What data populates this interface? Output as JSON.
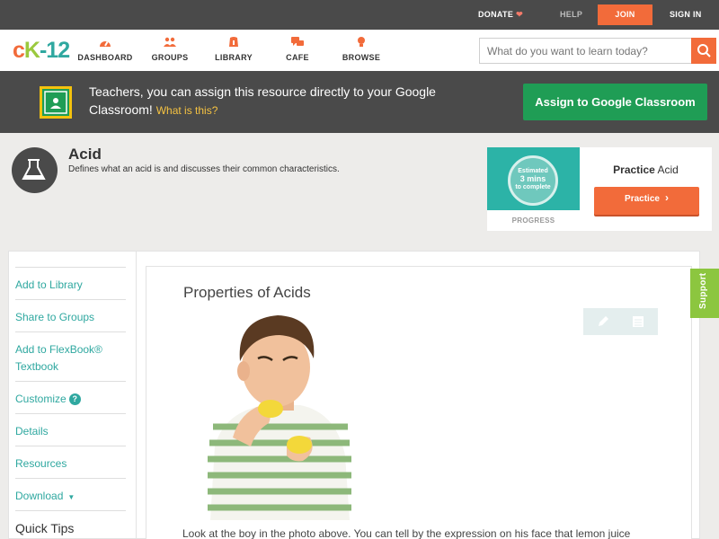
{
  "topbar": {
    "donate": "DONATE",
    "help": "HELP",
    "join": "JOIN",
    "signin": "SIGN IN"
  },
  "logo": {
    "c": "c",
    "k": "K",
    "n": "-12"
  },
  "nav": [
    {
      "label": "DASHBOARD",
      "icon": "dashboard-icon"
    },
    {
      "label": "GROUPS",
      "icon": "groups-icon"
    },
    {
      "label": "LIBRARY",
      "icon": "library-icon"
    },
    {
      "label": "CAFE",
      "icon": "cafe-icon"
    },
    {
      "label": "BROWSE",
      "icon": "browse-icon"
    }
  ],
  "search": {
    "placeholder": "What do you want to learn today?"
  },
  "banner": {
    "text": "Teachers, you can assign this resource directly to your Google Classroom!",
    "what_link": "What is this?",
    "assign_button": "Assign to Google Classroom"
  },
  "concept": {
    "title": "Acid",
    "description": "Defines what an acid is and discusses their common characteristics."
  },
  "practice": {
    "estimated_line1": "Estimated",
    "estimated_line2": "3 mins",
    "estimated_line3": "to complete",
    "progress_label": "PROGRESS",
    "name_prefix": "Practice",
    "name_topic": "Acid",
    "button": "Practice"
  },
  "sidebar": {
    "items": [
      "Add to Library",
      "Share to Groups",
      "Add to FlexBook® Textbook",
      "Customize",
      "Details",
      "Resources",
      "Download"
    ],
    "quick_tips": "Quick Tips"
  },
  "content": {
    "title": "Properties of Acids",
    "text": "Look at the boy in the photo above. You can tell by the expression on his face that lemon juice"
  },
  "support": {
    "label": "Support"
  },
  "colors": {
    "accent_orange": "#f26b3a",
    "teal": "#2fa8a0",
    "green": "#1f9d55",
    "dark_bar": "#4a4a4a",
    "support_green": "#8cc63f"
  }
}
